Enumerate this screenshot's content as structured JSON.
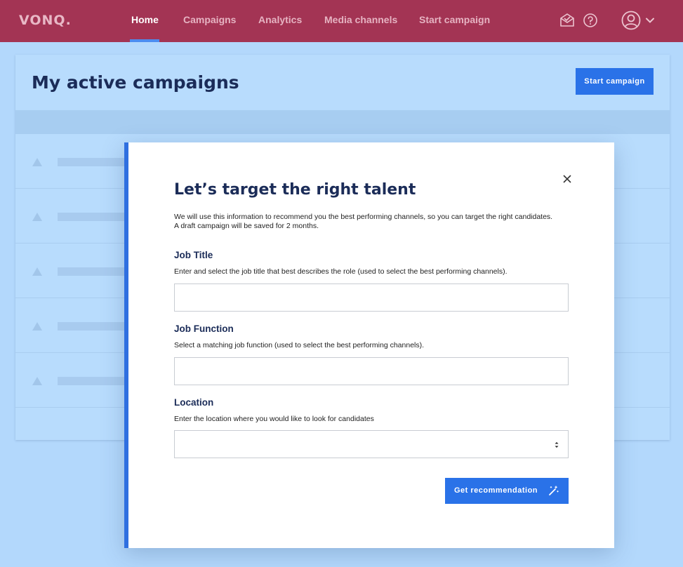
{
  "brand": {
    "logo_text": "VONQ."
  },
  "nav": {
    "items": [
      {
        "label": "Home",
        "active": true
      },
      {
        "label": "Campaigns"
      },
      {
        "label": "Analytics"
      },
      {
        "label": "Media channels"
      },
      {
        "label": "Start campaign"
      }
    ],
    "icons": [
      "mail-check-icon",
      "help-icon",
      "user-avatar-icon",
      "chevron-down-icon"
    ]
  },
  "page": {
    "title": "My active campaigns",
    "start_button": "Start campaign"
  },
  "modal": {
    "title": "Let’s target the right talent",
    "intro": "We will use this information to recommend you the best performing channels, so you can target the right candidates. A draft campaign will be saved for 2 months.",
    "fields": {
      "job_title": {
        "label": "Job Title",
        "help": "Enter and select the job title that best describes the role (used to select the best performing channels).",
        "value": ""
      },
      "job_function": {
        "label": "Job Function",
        "help": "Select a matching job function (used to select the best performing channels).",
        "value": ""
      },
      "location": {
        "label": "Location",
        "help": "Enter the location where you would like to look for candidates",
        "value": ""
      }
    },
    "submit_button": "Get recommendation"
  },
  "colors": {
    "nav_bg": "#a33454",
    "accent": "#2a72e8",
    "title_text": "#1b2c58",
    "page_bg": "#b3d8fc"
  }
}
